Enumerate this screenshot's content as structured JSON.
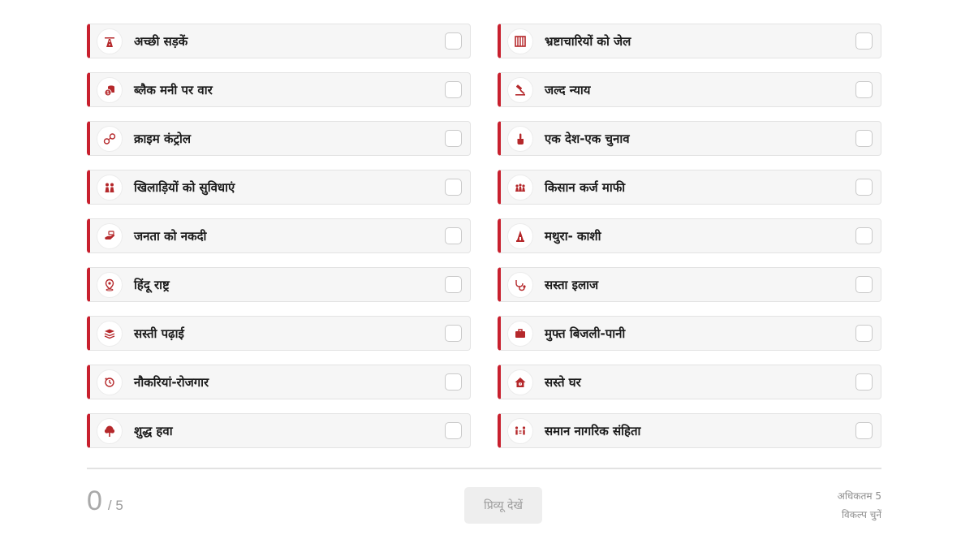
{
  "options": [
    {
      "label": "अच्छी सड़कें",
      "icon": "road-icon"
    },
    {
      "label": "भ्रष्टाचारियों को जेल",
      "icon": "jail-icon"
    },
    {
      "label": "ब्लैक मनी पर वार",
      "icon": "coins-icon"
    },
    {
      "label": "जल्द न्याय",
      "icon": "gavel-icon"
    },
    {
      "label": "क्राइम कंट्रोल",
      "icon": "handcuffs-icon"
    },
    {
      "label": "एक देश-एक चुनाव",
      "icon": "voting-finger-icon"
    },
    {
      "label": "खिलाड़ियों को सुविधाएं",
      "icon": "athletes-icon"
    },
    {
      "label": "किसान कर्ज माफी",
      "icon": "farmers-icon"
    },
    {
      "label": "जनता को नकदी",
      "icon": "cash-hand-icon"
    },
    {
      "label": "मथुरा- काशी",
      "icon": "temple-icon"
    },
    {
      "label": "हिंदू राष्ट्र",
      "icon": "location-pin-icon"
    },
    {
      "label": "सस्ता इलाज",
      "icon": "stethoscope-icon"
    },
    {
      "label": "सस्ती पढ़ाई",
      "icon": "books-icon"
    },
    {
      "label": "मुफ्त बिजली-पानी",
      "icon": "toolbox-icon"
    },
    {
      "label": "नौकरियां-रोजगार",
      "icon": "employment-icon"
    },
    {
      "label": "सस्ते घर",
      "icon": "house-icon"
    },
    {
      "label": "शुद्ध हवा",
      "icon": "tree-icon"
    },
    {
      "label": "समान नागरिक संहिता",
      "icon": "people-equal-icon"
    }
  ],
  "footer": {
    "selected_count": "0",
    "max_count": "/ 5",
    "preview_label": "प्रिव्यू देखें",
    "hint_line1": "अधिकतम 5",
    "hint_line2": "विकल्प चुनें"
  },
  "colors": {
    "accent": "#c8202e",
    "icon": "#b5282b",
    "card_bg": "#f6f6f6"
  }
}
